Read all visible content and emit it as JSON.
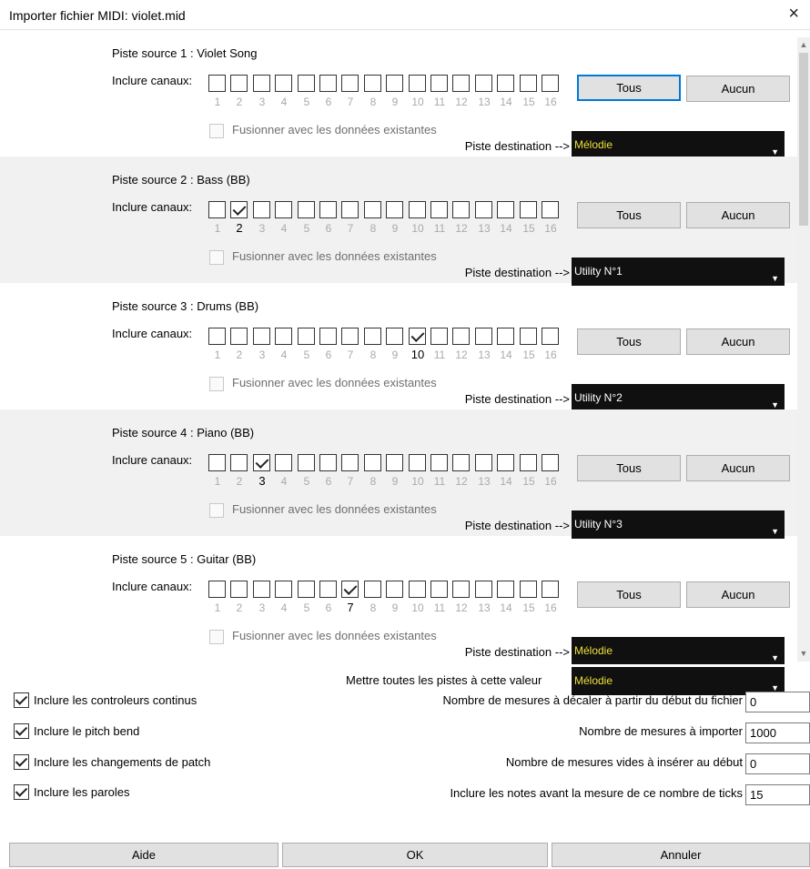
{
  "window": {
    "title": "Importer fichier MIDI: violet.mid",
    "close_icon": "×"
  },
  "channel_numbers": [
    "1",
    "2",
    "3",
    "4",
    "5",
    "6",
    "7",
    "8",
    "9",
    "10",
    "11",
    "12",
    "13",
    "14",
    "15",
    "16"
  ],
  "labels": {
    "include_channels": "Inclure canaux:",
    "merge": "Fusionner avec les données existantes",
    "destination": "Piste destination -->",
    "all": "Tous",
    "none": "Aucun"
  },
  "tracks": [
    {
      "source": "Piste source 1 : Violet Song",
      "checked": [],
      "destination": "Mélodie",
      "dest_color": "#f0e236",
      "all_focused": true
    },
    {
      "source": "Piste source 2 : Bass   (BB)",
      "checked": [
        2
      ],
      "destination": "Utility N°1",
      "dest_color": "#ffffff"
    },
    {
      "source": "Piste source 3 : Drums   (BB)",
      "checked": [
        10
      ],
      "destination": "Utility N°2",
      "dest_color": "#ffffff"
    },
    {
      "source": "Piste source 4 : Piano   (BB)",
      "checked": [
        3
      ],
      "destination": "Utility N°3",
      "dest_color": "#ffffff"
    },
    {
      "source": "Piste source 5 : Guitar  (BB)",
      "checked": [
        7
      ],
      "destination": "Mélodie",
      "dest_color": "#f0e236"
    }
  ],
  "set_all": {
    "label": "Mettre toutes les pistes à cette valeur",
    "value": "Mélodie"
  },
  "options": [
    {
      "label": "Inclure les controleurs continus",
      "checked": true
    },
    {
      "label": "Inclure le pitch bend",
      "checked": true
    },
    {
      "label": "Inclure les changements de patch",
      "checked": true
    },
    {
      "label": "Inclure les paroles",
      "checked": true
    }
  ],
  "numeric_fields": [
    {
      "label": "Nombre de mesures à décaler à partir du début du fichier",
      "value": "0"
    },
    {
      "label": "Nombre de mesures à importer",
      "value": "1000"
    },
    {
      "label": "Nombre de mesures vides à insérer au début",
      "value": "0"
    },
    {
      "label": "Inclure les notes avant la mesure de ce nombre de ticks",
      "value": "15"
    }
  ],
  "footer": {
    "help": "Aide",
    "ok": "OK",
    "cancel": "Annuler"
  }
}
